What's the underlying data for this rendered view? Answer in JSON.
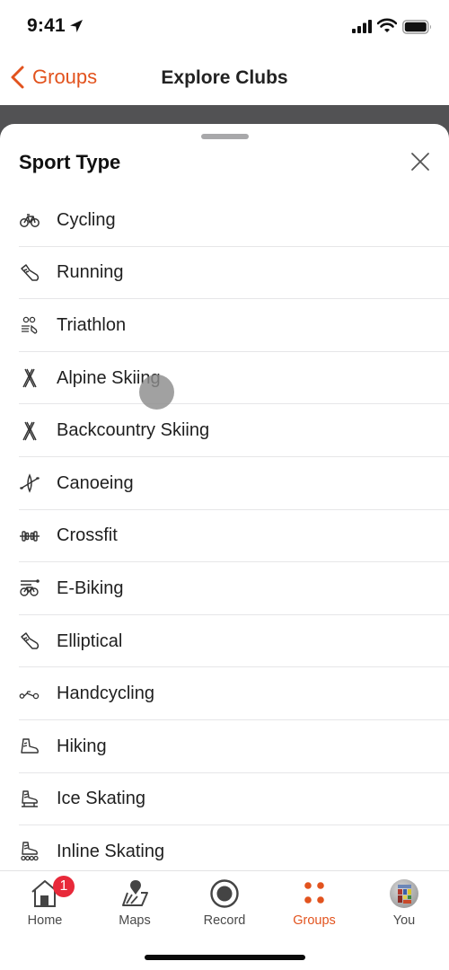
{
  "status_bar": {
    "time": "9:41",
    "icons": [
      "location-arrow-icon",
      "cellular-signal-icon",
      "wifi-icon",
      "battery-icon"
    ]
  },
  "nav": {
    "back_label": "Groups",
    "title": "Explore Clubs"
  },
  "sheet": {
    "title": "Sport Type",
    "close_icon": "close-icon",
    "items": [
      {
        "label": "Cycling",
        "icon": "bicycle-icon"
      },
      {
        "label": "Running",
        "icon": "running-shoe-icon"
      },
      {
        "label": "Triathlon",
        "icon": "triathlon-icon"
      },
      {
        "label": "Alpine Skiing",
        "icon": "skis-icon"
      },
      {
        "label": "Backcountry Skiing",
        "icon": "skis-icon"
      },
      {
        "label": "Canoeing",
        "icon": "canoe-icon"
      },
      {
        "label": "Crossfit",
        "icon": "dumbbell-icon"
      },
      {
        "label": "E-Biking",
        "icon": "ebike-icon"
      },
      {
        "label": "Elliptical",
        "icon": "sneaker-icon"
      },
      {
        "label": "Handcycling",
        "icon": "handcycle-icon"
      },
      {
        "label": "Hiking",
        "icon": "hiking-boot-icon"
      },
      {
        "label": "Ice Skating",
        "icon": "ice-skate-icon"
      },
      {
        "label": "Inline Skating",
        "icon": "inline-skate-icon"
      }
    ]
  },
  "tab_bar": {
    "tabs": [
      {
        "label": "Home",
        "icon": "home-icon",
        "badge": "1",
        "active": false
      },
      {
        "label": "Maps",
        "icon": "map-pin-icon",
        "active": false
      },
      {
        "label": "Record",
        "icon": "record-icon",
        "active": false
      },
      {
        "label": "Groups",
        "icon": "groups-icon",
        "active": true
      },
      {
        "label": "You",
        "icon": "avatar",
        "active": false
      }
    ]
  },
  "colors": {
    "accent": "#e2531e",
    "badge": "#e8293a",
    "text": "#1f1f1f",
    "overlay": "#525254"
  }
}
